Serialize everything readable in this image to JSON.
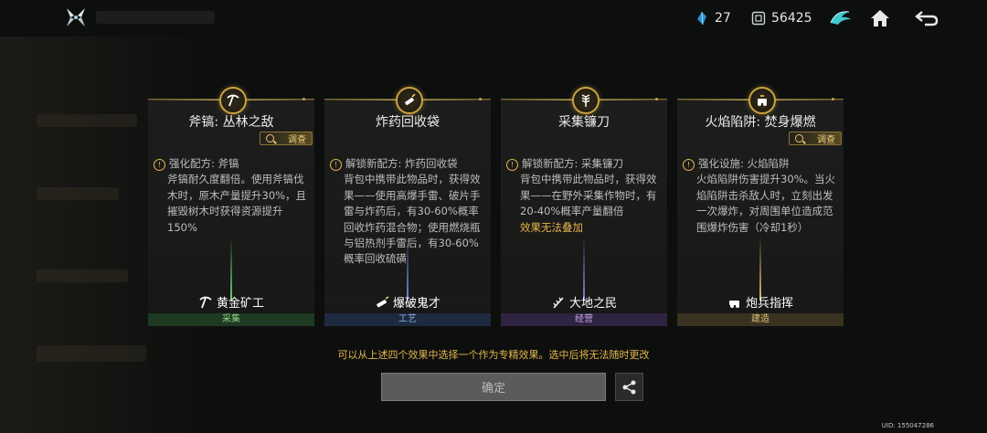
{
  "header": {
    "energy_value": "27",
    "currency_value": "56425"
  },
  "cards": [
    {
      "title": "斧镐: 丛林之敌",
      "investigate": "调查",
      "effect_head": "强化配方: 斧镐",
      "effect_body": "斧镐耐久度翻倍。使用斧镐伐木时，原木产量提升30%，且摧毁树木时获得资源提升150%",
      "warning": "",
      "specialist": "黄金矿工",
      "category": "采集",
      "category_color": "#8fd08a",
      "category_bg": "#1e3a22",
      "badge_icon": "pickaxe-icon",
      "glow_color": "#66d27a"
    },
    {
      "title": "炸药回收袋",
      "investigate": "",
      "effect_head": "解锁新配方: 炸药回收袋",
      "effect_body": "背包中携带此物品时，获得效果——使用高爆手雷、破片手雷与炸药后，有30-60%概率回收炸药混合物；使用燃烧瓶与铝热剂手雷后，有30-60%概率回收硫磺",
      "warning": "",
      "specialist": "爆破鬼才",
      "category": "工艺",
      "category_color": "#8fb0e0",
      "category_bg": "#1d2a40",
      "badge_icon": "dynamite-icon",
      "glow_color": "#6a8fe0"
    },
    {
      "title": "采集镰刀",
      "investigate": "",
      "effect_head": "解锁新配方: 采集镰刀",
      "effect_body": "背包中携带此物品时，获得效果——在野外采集作物时，有20-40%概率产量翻倍",
      "warning": "效果无法叠加",
      "specialist": "大地之民",
      "category": "经营",
      "category_color": "#c8a8e8",
      "category_bg": "#2e2340",
      "badge_icon": "wheat-icon",
      "glow_color": "#9a7ad0"
    },
    {
      "title": "火焰陷阱: 焚身爆燃",
      "investigate": "调查",
      "effect_head": "强化设施: 火焰陷阱",
      "effect_body": "火焰陷阱伤害提升30%。当火焰陷阱击杀敌人时，立刻出发一次爆炸，对周围单位造成范围爆炸伤害（冷却1秒）",
      "warning": "",
      "specialist": "炮兵指挥",
      "category": "建造",
      "category_color": "#e0c27a",
      "category_bg": "#3a3220",
      "badge_icon": "cannon-icon",
      "glow_color": "#e0c070"
    }
  ],
  "hint": "可以从上述四个效果中选择一个作为专精效果。选中后将无法随时更改",
  "confirm_label": "确定",
  "uid": "UID: 155047286"
}
